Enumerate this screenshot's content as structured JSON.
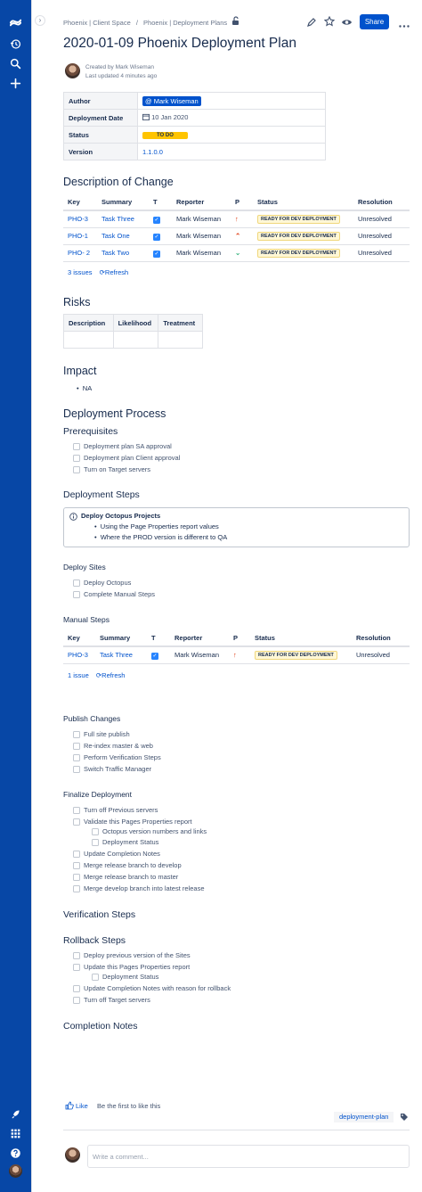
{
  "breadcrumb": {
    "space": "Phoenix | Client Space",
    "separator": "/",
    "parent": "Phoenix | Deployment Plans"
  },
  "toolbar": {
    "share_label": "Share"
  },
  "page": {
    "title": "2020-01-09 Phoenix Deployment Plan",
    "created_by": "Created by Mark Wiseman",
    "last_updated": "Last updated 4 minutes ago"
  },
  "properties": {
    "author_label": "Author",
    "author_value": "@ Mark Wiseman",
    "date_label": "Deployment Date",
    "date_value": "10 Jan 2020",
    "status_label": "Status",
    "status_value": "TO DO",
    "version_label": "Version",
    "version_value": "1.1.0.0"
  },
  "jira_headers": {
    "key": "Key",
    "summary": "Summary",
    "t": "T",
    "reporter": "Reporter",
    "p": "P",
    "status": "Status",
    "resolution": "Resolution"
  },
  "description": {
    "heading": "Description of Change",
    "rows": [
      {
        "key": "PHO-3",
        "summary": "Task Three",
        "reporter": "Mark Wiseman",
        "priority": "↑",
        "status": "READY FOR DEV DEPLOYMENT",
        "resolution": "Unresolved"
      },
      {
        "key": "PHO-1",
        "summary": "Task One",
        "reporter": "Mark Wiseman",
        "priority": "⌃",
        "status": "READY FOR DEV DEPLOYMENT",
        "resolution": "Unresolved"
      },
      {
        "key": "PHO- 2",
        "summary": "Task Two",
        "reporter": "Mark Wiseman",
        "priority": "⌄",
        "status": "READY FOR DEV DEPLOYMENT",
        "resolution": "Unresolved"
      }
    ],
    "count": "3 issues",
    "refresh": "Refresh"
  },
  "risks": {
    "heading": "Risks",
    "headers": [
      "Description",
      "Likelihood",
      "Treatment"
    ]
  },
  "impact": {
    "heading": "Impact",
    "items": [
      "NA"
    ]
  },
  "process": {
    "heading": "Deployment Process",
    "prereq_heading": "Prerequisites",
    "prereqs": [
      "Deployment plan SA approval",
      "Deployment plan Client approval",
      "Turn on Target servers"
    ]
  },
  "steps": {
    "heading": "Deployment Steps",
    "info_title": "Deploy Octopus Projects",
    "info_items": [
      "Using the Page Properties report values",
      "Where the PROD version is different to QA"
    ]
  },
  "deploy_sites": {
    "heading": "Deploy Sites",
    "items": [
      "Deploy Octopus",
      "Complete Manual Steps"
    ]
  },
  "manual": {
    "heading": "Manual Steps",
    "rows": [
      {
        "key": "PHO-3",
        "summary": "Task Three",
        "reporter": "Mark Wiseman",
        "priority": "↑",
        "status": "READY FOR DEV DEPLOYMENT",
        "resolution": "Unresolved"
      }
    ],
    "count": "1 issue",
    "refresh": "Refresh"
  },
  "publish": {
    "heading": "Publish Changes",
    "items": [
      "Full site publish",
      "Re-index master & web",
      "Perform Verification Steps",
      "Switch Traffic Manager"
    ]
  },
  "finalize": {
    "heading": "Finalize Deployment",
    "items": [
      "Turn off Previous servers",
      "Validate this Pages Properties report",
      "Octopus version numbers and links",
      "Deployment Status",
      "Update Completion Notes",
      "Merge release branch to develop",
      "Merge release branch to master",
      "Merge develop branch into latest release"
    ]
  },
  "verification": {
    "heading": "Verification Steps"
  },
  "rollback": {
    "heading": "Rollback Steps",
    "items": [
      "Deploy previous version of the Sites",
      "Update this Pages Properties report",
      "Deployment Status",
      "Update Completion Notes with reason for rollback",
      "Turn off Target servers"
    ]
  },
  "completion": {
    "heading": "Completion Notes"
  },
  "footer": {
    "like_label": "Like",
    "like_text": "Be the first to like this",
    "label_tag": "deployment-plan",
    "comment_placeholder": "Write a comment..."
  },
  "colors": {
    "nav": "#0747A6",
    "accent": "#0052CC",
    "status_todo": "#FFC400",
    "checkbox": "#2684FF"
  }
}
